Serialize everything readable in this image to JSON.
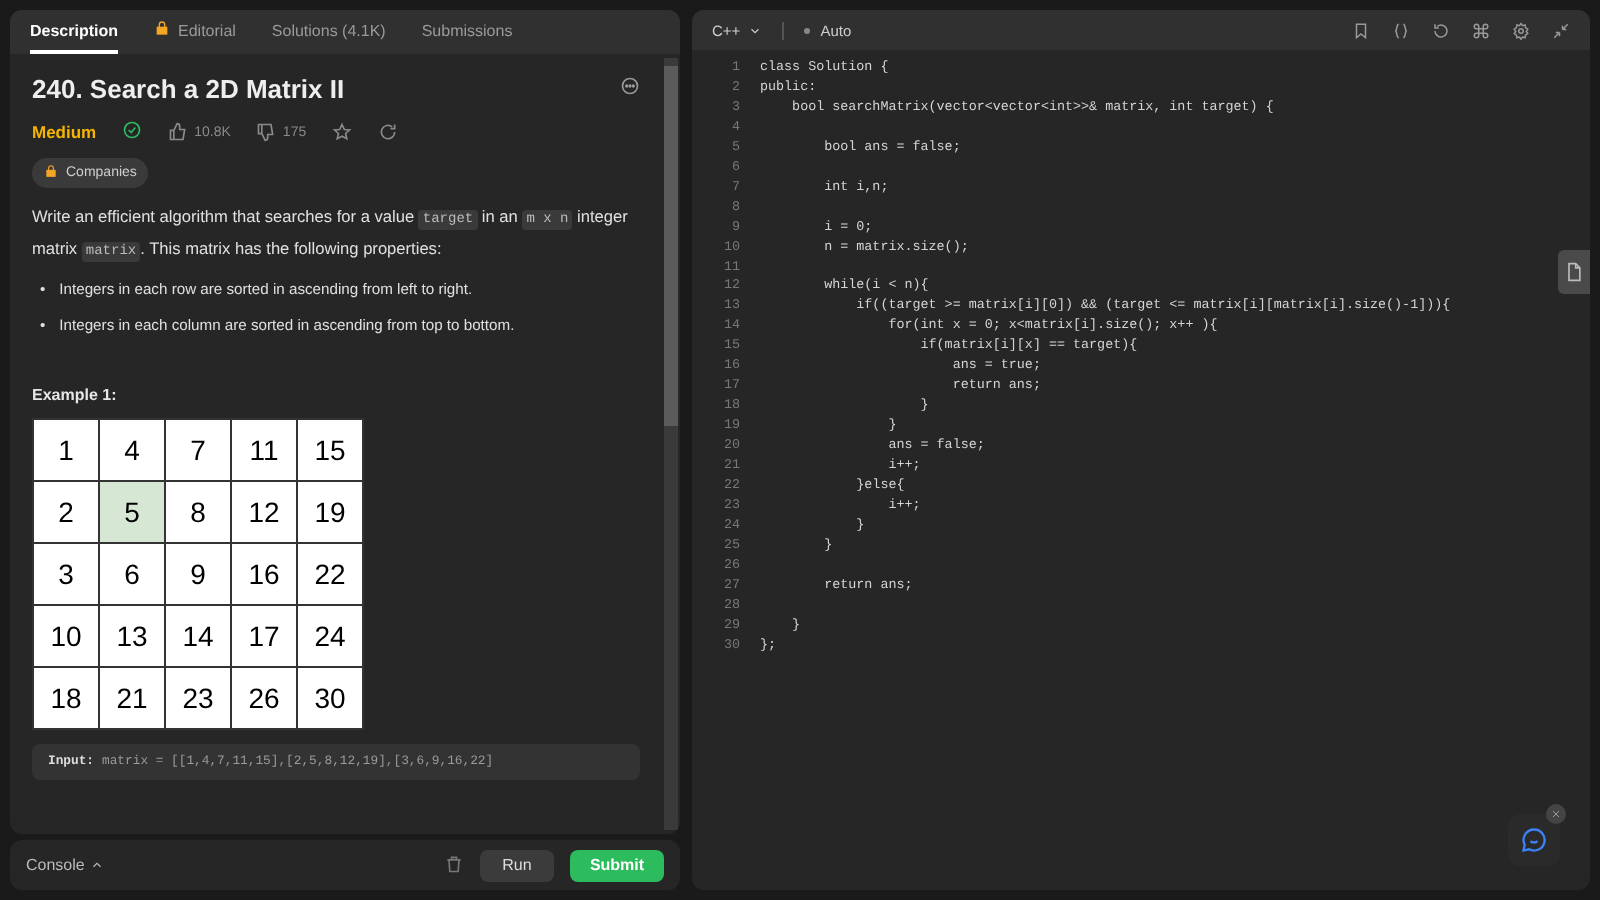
{
  "left_tabs": [
    {
      "label": "Description",
      "locked": false,
      "selected": true
    },
    {
      "label": "Editorial",
      "locked": true,
      "selected": false
    },
    {
      "label": "Solutions (4.1K)",
      "locked": false,
      "selected": false
    },
    {
      "label": "Submissions",
      "locked": false,
      "selected": false
    }
  ],
  "problem": {
    "title": "240. Search a 2D Matrix II",
    "difficulty": "Medium",
    "solved": true,
    "likes": "10.8K",
    "dislikes": "175",
    "companies": "Companies",
    "description": [
      {
        "kind": "text",
        "text": "Write an efficient algorithm that searches for a value "
      },
      {
        "kind": "code",
        "text": "target"
      },
      {
        "kind": "text",
        "text": " in an "
      },
      {
        "kind": "code",
        "text": "m x n"
      },
      {
        "kind": "text",
        "text": " integer matrix "
      },
      {
        "kind": "code",
        "text": "matrix"
      },
      {
        "kind": "text",
        "text": ". This matrix has the following properties:"
      }
    ],
    "bullets": [
      {
        "marker": "•",
        "text": "Integers in each row are sorted in ascending from left to right."
      },
      {
        "marker": "•",
        "text": "Integers in each column are sorted in ascending from top to bottom."
      }
    ],
    "example_title": "Example 1:",
    "matrix": [
      [
        {
          "value": "1",
          "selected": false
        },
        {
          "value": "4",
          "selected": false
        },
        {
          "value": "7",
          "selected": false
        },
        {
          "value": "11",
          "selected": false
        },
        {
          "value": "15",
          "selected": false
        }
      ],
      [
        {
          "value": "2",
          "selected": false
        },
        {
          "value": "5",
          "selected": true
        },
        {
          "value": "8",
          "selected": false
        },
        {
          "value": "12",
          "selected": false
        },
        {
          "value": "19",
          "selected": false
        }
      ],
      [
        {
          "value": "3",
          "selected": false
        },
        {
          "value": "6",
          "selected": false
        },
        {
          "value": "9",
          "selected": false
        },
        {
          "value": "16",
          "selected": false
        },
        {
          "value": "22",
          "selected": false
        }
      ],
      [
        {
          "value": "10",
          "selected": false
        },
        {
          "value": "13",
          "selected": false
        },
        {
          "value": "14",
          "selected": false
        },
        {
          "value": "17",
          "selected": false
        },
        {
          "value": "24",
          "selected": false
        }
      ],
      [
        {
          "value": "18",
          "selected": false
        },
        {
          "value": "21",
          "selected": false
        },
        {
          "value": "23",
          "selected": false
        },
        {
          "value": "26",
          "selected": false
        },
        {
          "value": "30",
          "selected": false
        }
      ]
    ],
    "input_label": "Input:",
    "input_value": "matrix = [[1,4,7,11,15],[2,5,8,12,19],[3,6,9,16,22]"
  },
  "bottom_bar": {
    "console": "Console",
    "run": "Run",
    "submit": "Submit"
  },
  "editor": {
    "language": "C++",
    "mode": "Auto",
    "lines": [
      {
        "number": "1",
        "text": "class Solution {"
      },
      {
        "number": "2",
        "text": "public:"
      },
      {
        "number": "3",
        "text": "    bool searchMatrix(vector<vector<int>>& matrix, int target) {"
      },
      {
        "number": "4"
      },
      {
        "number": "5",
        "text": "        bool ans = false;"
      },
      {
        "number": "6"
      },
      {
        "number": "7",
        "text": "        int i,n;"
      },
      {
        "number": "8"
      },
      {
        "number": "9",
        "text": "        i = 0;"
      },
      {
        "number": "10",
        "text": "        n = matrix.size();"
      },
      {
        "number": "11"
      },
      {
        "number": "12",
        "text": "        while(i < n){"
      },
      {
        "number": "13",
        "text": "            if((target >= matrix[i][0]) && (target <= matrix[i][matrix[i].size()-1])){"
      },
      {
        "number": "14",
        "text": "                for(int x = 0; x<matrix[i].size(); x++ ){"
      },
      {
        "number": "15",
        "text": "                    if(matrix[i][x] == target){"
      },
      {
        "number": "16",
        "text": "                        ans = true;"
      },
      {
        "number": "17",
        "text": "                        return ans;"
      },
      {
        "number": "18",
        "text": "                    }"
      },
      {
        "number": "19",
        "text": "                }"
      },
      {
        "number": "20",
        "text": "                ans = false;"
      },
      {
        "number": "21",
        "text": "                i++;"
      },
      {
        "number": "22",
        "text": "            }else{"
      },
      {
        "number": "23",
        "text": "                i++;"
      },
      {
        "number": "24",
        "text": "            }"
      },
      {
        "number": "25",
        "text": "        }"
      },
      {
        "number": "26"
      },
      {
        "number": "27",
        "text": "        return ans;"
      },
      {
        "number": "28"
      },
      {
        "number": "29",
        "text": "    }"
      },
      {
        "number": "30",
        "text": "};"
      }
    ]
  }
}
